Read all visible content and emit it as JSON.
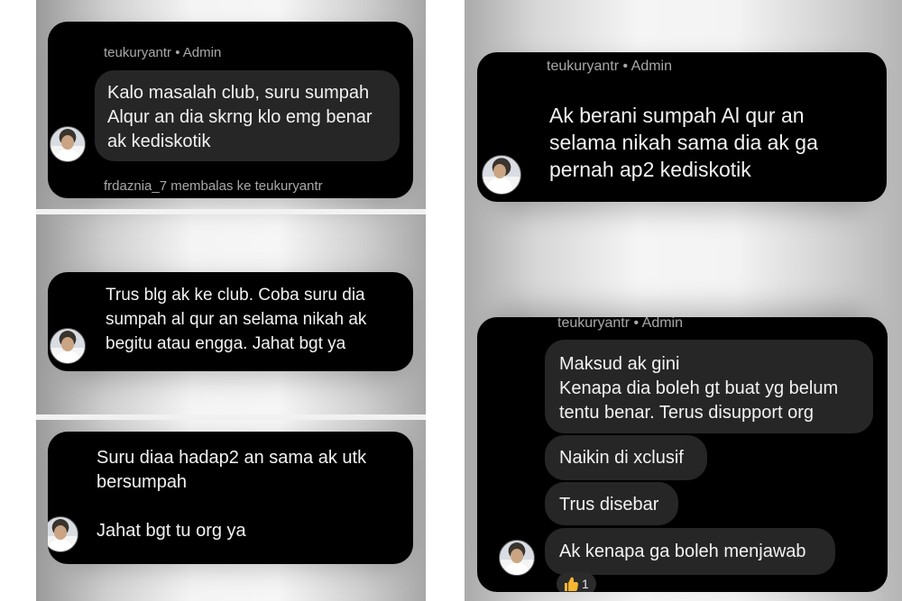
{
  "left_column": {
    "panel1": {
      "author": "teukuryantr • Admin",
      "message": "Kalo masalah club, suru sumpah\nAlqur an dia skrng klo emg benar\nak kediskotik",
      "reply_label": "frdaznia_7 membalas ke teukuryantr"
    },
    "panel2": {
      "message": "Trus blg ak ke club. Coba suru dia\nsumpah al qur an selama nikah ak\nbegitu atau engga. Jahat bgt ya"
    },
    "panel3": {
      "message": "Suru diaa hadap2 an sama ak utk\nbersumpah\n\nJahat bgt tu org ya"
    }
  },
  "right_column": {
    "panel1": {
      "author": "teukuryantr • Admin",
      "message": "Ak berani sumpah Al qur an\nselama nikah sama dia ak ga\npernah ap2 kediskotik"
    },
    "panel2": {
      "author": "teukuryantr • Admin",
      "messages": [
        "Maksud ak gini\nKenapa dia boleh gt buat yg belum\ntentu benar. Terus disupport org",
        "Naikin di xclusif",
        "Trus disebar",
        "Ak kenapa ga boleh menjawab"
      ],
      "reaction": {
        "icon": "thumbs-up-icon",
        "count": "1"
      }
    }
  },
  "colors": {
    "panel": "#000000",
    "bubble": "#262626",
    "text": "#f2f2f2",
    "meta": "#a8a8a8",
    "reaction_emoji": "#f5b731"
  }
}
